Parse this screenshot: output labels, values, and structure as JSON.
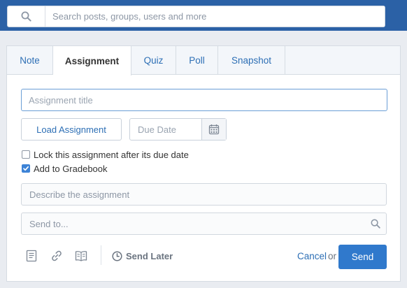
{
  "colors": {
    "topbar": "#2b61a6",
    "accent": "#2d6fb5",
    "send_button": "#3079cc",
    "checkbox_checked": "#3d83d6"
  },
  "search": {
    "placeholder": "Search posts, groups, users and more",
    "icon": "search-icon"
  },
  "tabs": [
    {
      "label": "Note",
      "active": false
    },
    {
      "label": "Assignment",
      "active": true
    },
    {
      "label": "Quiz",
      "active": false
    },
    {
      "label": "Poll",
      "active": false
    },
    {
      "label": "Snapshot",
      "active": false
    }
  ],
  "form": {
    "title_placeholder": "Assignment title",
    "load_label": "Load Assignment",
    "due_placeholder": "Due Date",
    "due_icon": "calendar-icon",
    "lock_label": "Lock this assignment after its due date",
    "lock_checked": false,
    "gradebook_label": "Add to Gradebook",
    "gradebook_checked": true,
    "describe_placeholder": "Describe the assignment",
    "sendto_placeholder": "Send to..."
  },
  "toolbar": {
    "icons": [
      "note-icon",
      "link-icon",
      "library-icon"
    ],
    "send_later_label": "Send Later",
    "cancel_label": "Cancel",
    "or_label": "or",
    "send_label": "Send"
  }
}
